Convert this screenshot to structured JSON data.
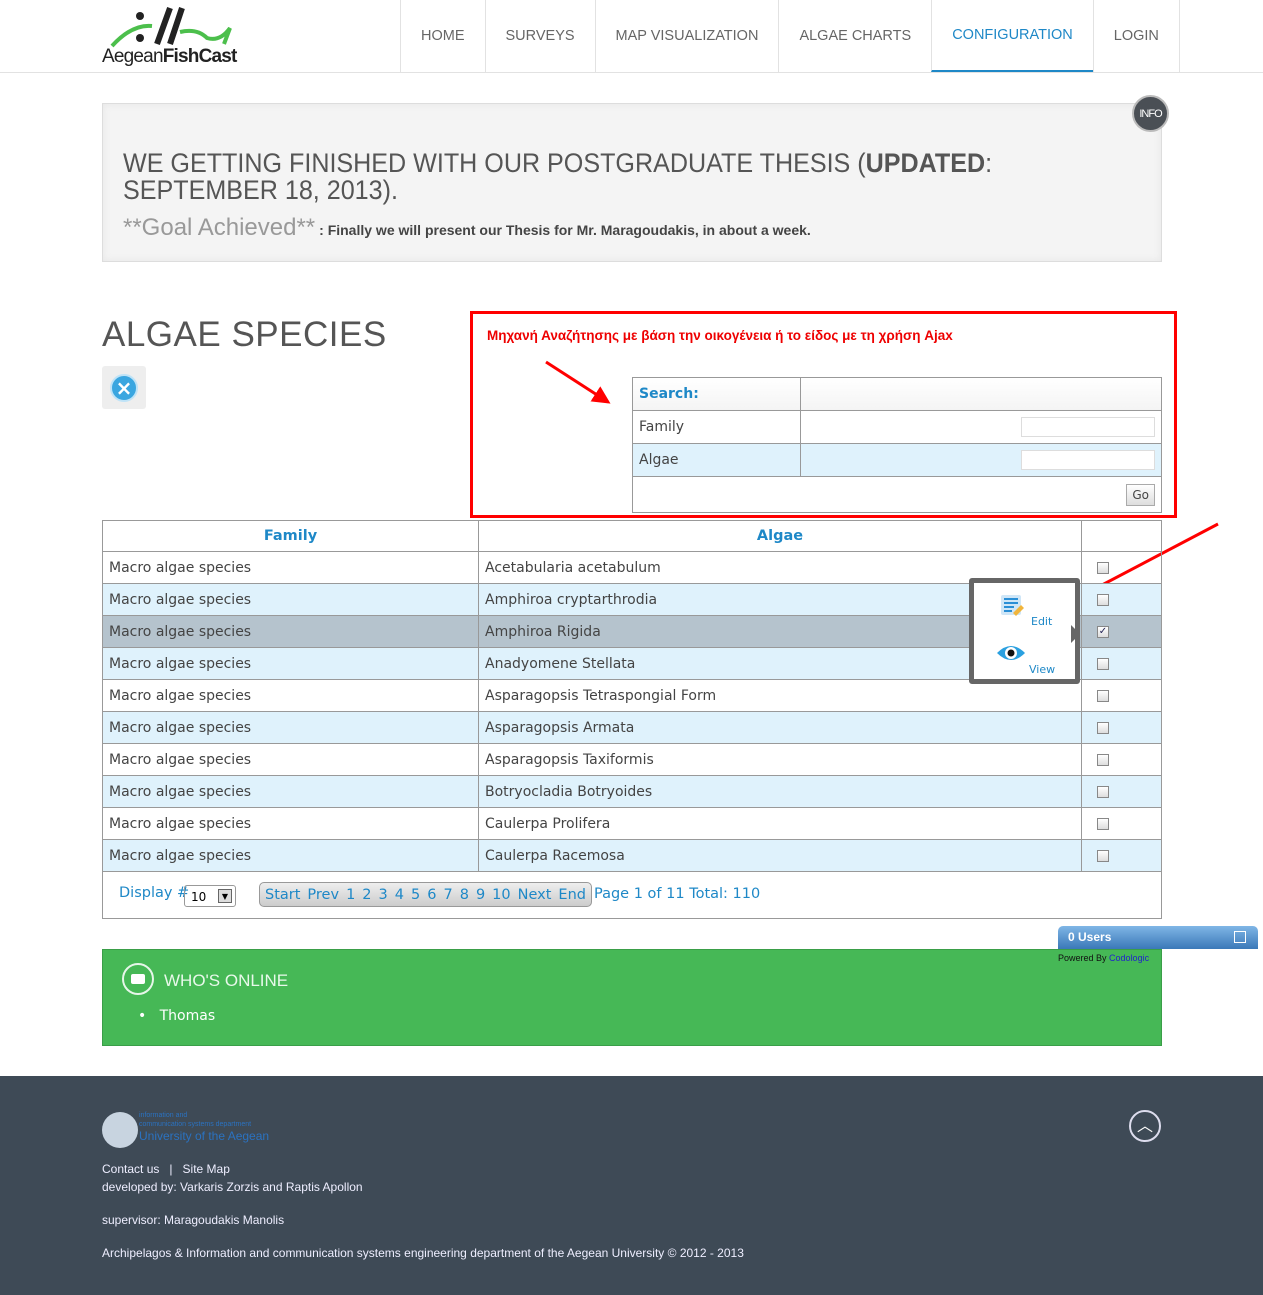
{
  "logo": {
    "part1": "Aegean",
    "part2": "FishCast"
  },
  "nav": [
    {
      "label": "HOME"
    },
    {
      "label": "SURVEYS"
    },
    {
      "label": "MAP VISUALIZATION"
    },
    {
      "label": "ALGAE CHARTS"
    },
    {
      "label": "CONFIGURATION",
      "active": true
    },
    {
      "label": "LOGIN"
    }
  ],
  "banner": {
    "title_pre": "WE GETTING FINISHED WITH OUR POSTGRADUATE THESIS (",
    "title_bold": "UPDATED",
    "title_post": ": SEPTEMBER 18, 2013).",
    "goal": "**Goal Achieved**",
    "goal_text": ": Finally we will present our Thesis for Mr. Maragoudakis, in about a week.",
    "badge": "INFO"
  },
  "page_title": "ALGAE SPECIES",
  "annotation": {
    "text": "Μηχανή Αναζήτησης με βάση την οικογένεια ή το είδος με τη χρήση Ajax",
    "color": "#ff0000"
  },
  "search": {
    "header": "Search:",
    "family_label": "Family",
    "family_value": "",
    "algae_label": "Algae",
    "algae_value": "",
    "go": "Go"
  },
  "table": {
    "headers": [
      "Family",
      "Algae",
      ""
    ],
    "rows": [
      {
        "family": "Macro algae species",
        "algae": "Acetabularia acetabulum",
        "checked": false
      },
      {
        "family": "Macro algae species",
        "algae": "Amphiroa cryptarthrodia",
        "checked": false
      },
      {
        "family": "Macro algae species",
        "algae": "Amphiroa Rigida",
        "checked": true
      },
      {
        "family": "Macro algae species",
        "algae": "Anadyomene Stellata",
        "checked": false
      },
      {
        "family": "Macro algae species",
        "algae": "Asparagopsis Tetraspongial Form",
        "checked": false
      },
      {
        "family": "Macro algae species",
        "algae": "Asparagopsis Armata",
        "checked": false
      },
      {
        "family": "Macro algae species",
        "algae": "Asparagopsis Taxiformis",
        "checked": false
      },
      {
        "family": "Macro algae species",
        "algae": "Botryocladia Botryoides",
        "checked": false
      },
      {
        "family": "Macro algae species",
        "algae": "Caulerpa Prolifera",
        "checked": false
      },
      {
        "family": "Macro algae species",
        "algae": "Caulerpa Racemosa",
        "checked": false
      }
    ]
  },
  "popup": {
    "edit": "Edit",
    "view": "View"
  },
  "pager": {
    "display_label": "Display #",
    "display_value": "10",
    "links": [
      "Start",
      "Prev",
      "1",
      "2",
      "3",
      "4",
      "5",
      "6",
      "7",
      "8",
      "9",
      "10",
      "Next",
      "End"
    ],
    "info": "Page 1 of 11 Total: 110"
  },
  "users_widget": {
    "label": "0 Users",
    "powered": "Powered By",
    "brand": "Codologic"
  },
  "online": {
    "title": "WHO'S ONLINE",
    "users": [
      "Thomas"
    ]
  },
  "footer": {
    "uni_line1": "information and",
    "uni_line2": "communication systems department",
    "uni_name": "University of the Aegean",
    "contact": "Contact us",
    "sep": "|",
    "sitemap": "Site Map",
    "developed": "developed by: Varkaris Zorzis and Raptis Apollon",
    "supervisor": "supervisor: Maragoudakis Manolis",
    "copyright": "Archipelagos & Information and communication systems engineering department of the Aegean University  © 2012 - 2013"
  },
  "colors": {
    "accent": "#1e88c7",
    "green": "#46b856",
    "footer": "#3e4a56",
    "annotation": "#ff0000"
  }
}
